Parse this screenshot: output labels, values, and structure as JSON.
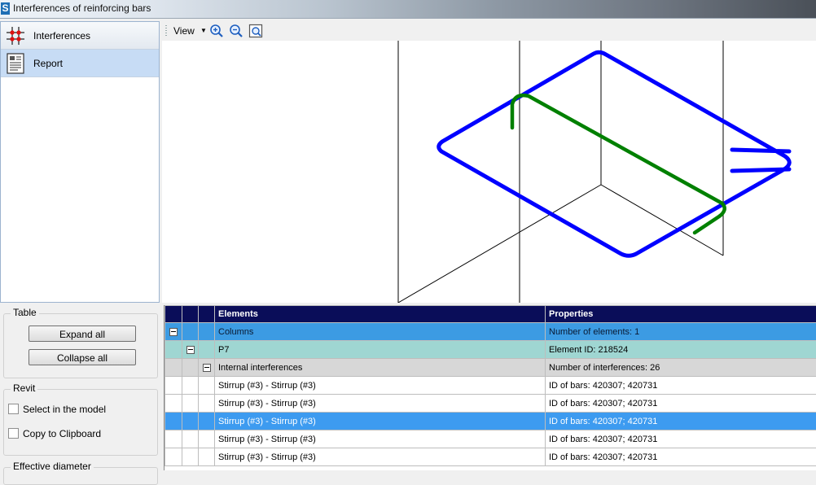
{
  "window": {
    "title": "Interferences of reinforcing bars",
    "app_icon_letter": "S"
  },
  "nav": {
    "items": [
      {
        "label": "Interferences",
        "icon": "interference-grid-icon",
        "active": false
      },
      {
        "label": "Report",
        "icon": "report-document-icon",
        "active": true
      }
    ]
  },
  "table_group": {
    "title": "Table",
    "expand_label": "Expand all",
    "collapse_label": "Collapse all"
  },
  "revit_group": {
    "title": "Revit",
    "select_label": "Select in the model",
    "copy_label": "Copy to Clipboard"
  },
  "effective_group": {
    "title": "Effective diameter"
  },
  "toolbar": {
    "view_label": "View",
    "zoom_in_icon": "zoom-in-icon",
    "zoom_out_icon": "zoom-out-icon",
    "zoom_extents_icon": "zoom-extents-icon"
  },
  "viewport": {
    "stirrup_color": "#0000ff",
    "bar_color": "#008000"
  },
  "grid": {
    "headers": {
      "elements": "Elements",
      "properties": "Properties"
    },
    "rows": [
      {
        "kind": "columns",
        "element": "Columns",
        "property": "Number of elements: 1"
      },
      {
        "kind": "p7",
        "element": "P7",
        "property": "Element ID: 218524"
      },
      {
        "kind": "internal",
        "element": "Internal interferences",
        "property": "Number of interferences: 26"
      },
      {
        "kind": "item",
        "element": "Stirrup (#3) - Stirrup (#3)",
        "property": "ID of bars: 420307; 420731"
      },
      {
        "kind": "item",
        "element": "Stirrup (#3) - Stirrup (#3)",
        "property": "ID of bars: 420307; 420731"
      },
      {
        "kind": "selected",
        "element": "Stirrup (#3) - Stirrup (#3)",
        "property": "ID of bars: 420307; 420731"
      },
      {
        "kind": "item",
        "element": "Stirrup (#3) - Stirrup (#3)",
        "property": "ID of bars: 420307; 420731"
      },
      {
        "kind": "item",
        "element": "Stirrup (#3) - Stirrup (#3)",
        "property": "ID of bars: 420307; 420731"
      }
    ]
  }
}
